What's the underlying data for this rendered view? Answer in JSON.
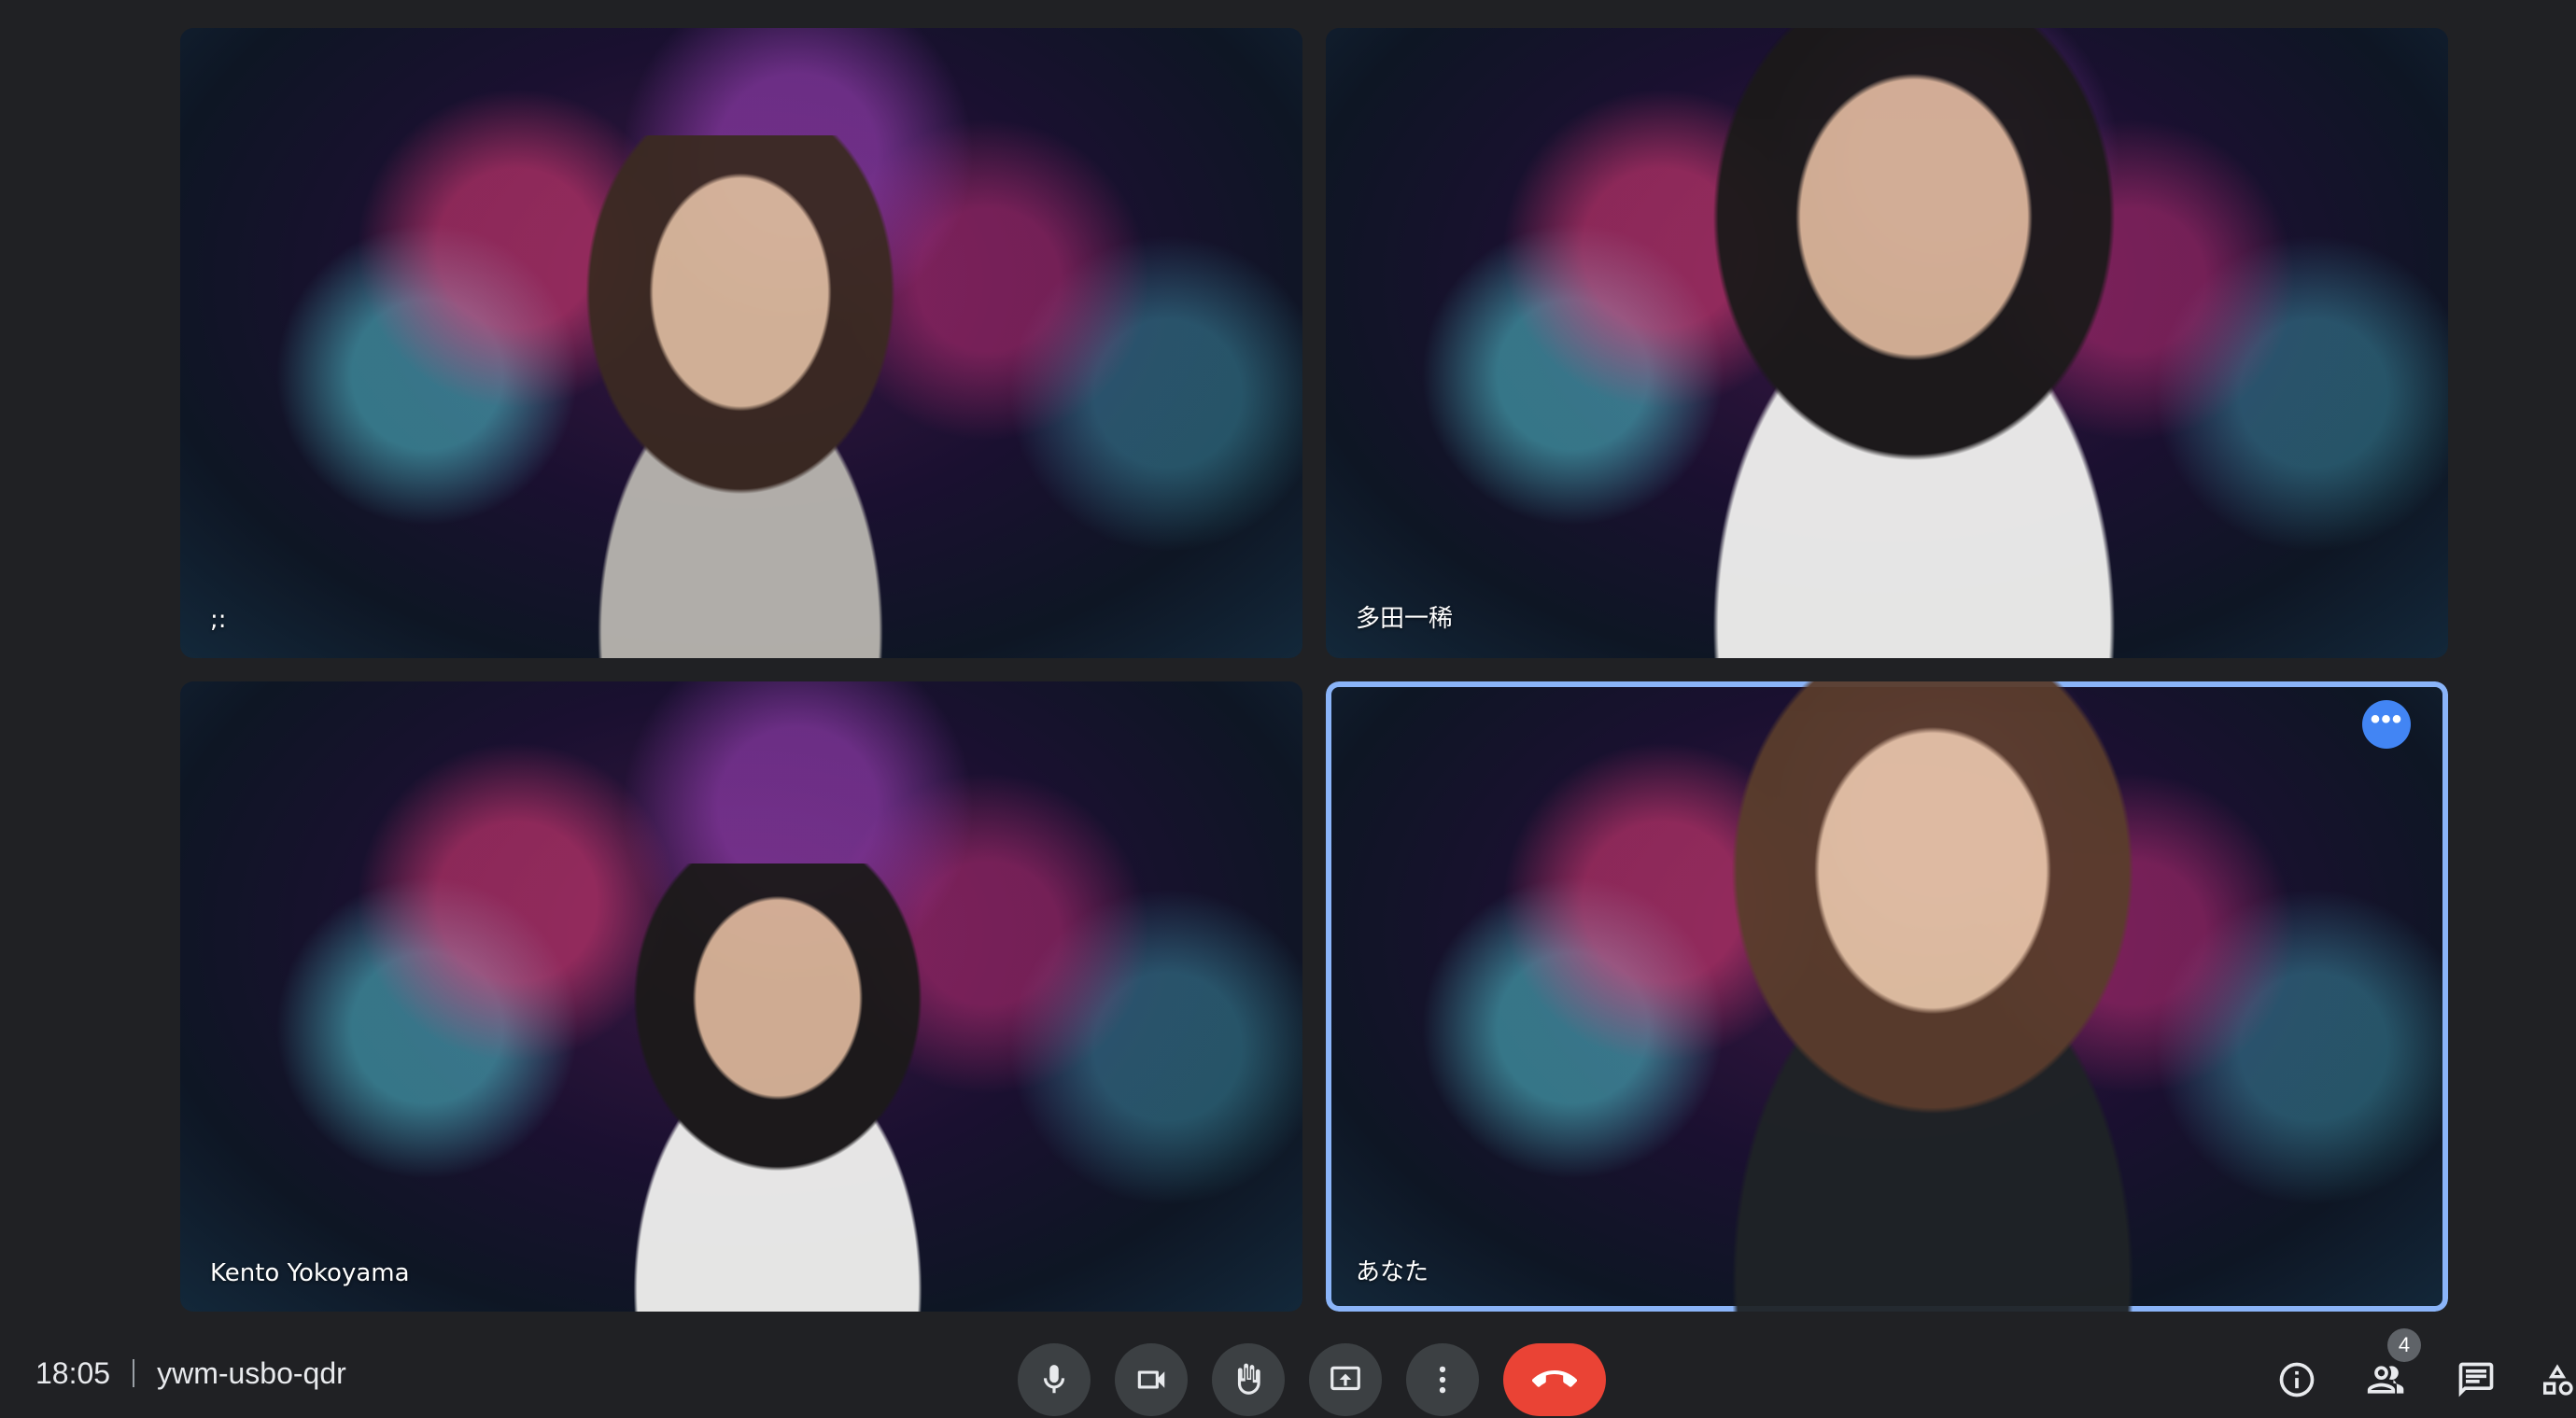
{
  "participants": [
    {
      "name": ";:"
    },
    {
      "name": "多田一稀"
    },
    {
      "name": "Kento Yokoyama"
    },
    {
      "name": "あなた"
    }
  ],
  "meeting": {
    "time": "18:05",
    "code": "ywm-usbo-qdr"
  },
  "controls": {
    "mic_icon": "mic-icon",
    "camera_icon": "videocam-icon",
    "raise_hand_icon": "raise-hand-icon",
    "present_icon": "present-screen-icon",
    "more_icon": "more-vert-icon",
    "end_call_icon": "call-end-icon"
  },
  "side": {
    "people_count": "4",
    "info_icon": "info-icon",
    "people_icon": "people-icon",
    "chat_icon": "chat-icon",
    "activities_icon": "activities-icon"
  },
  "colors": {
    "background": "#202124",
    "control_bg": "#3c4043",
    "end_call": "#ea4335",
    "active_border": "#8ab4f8",
    "accent": "#4285f4"
  }
}
